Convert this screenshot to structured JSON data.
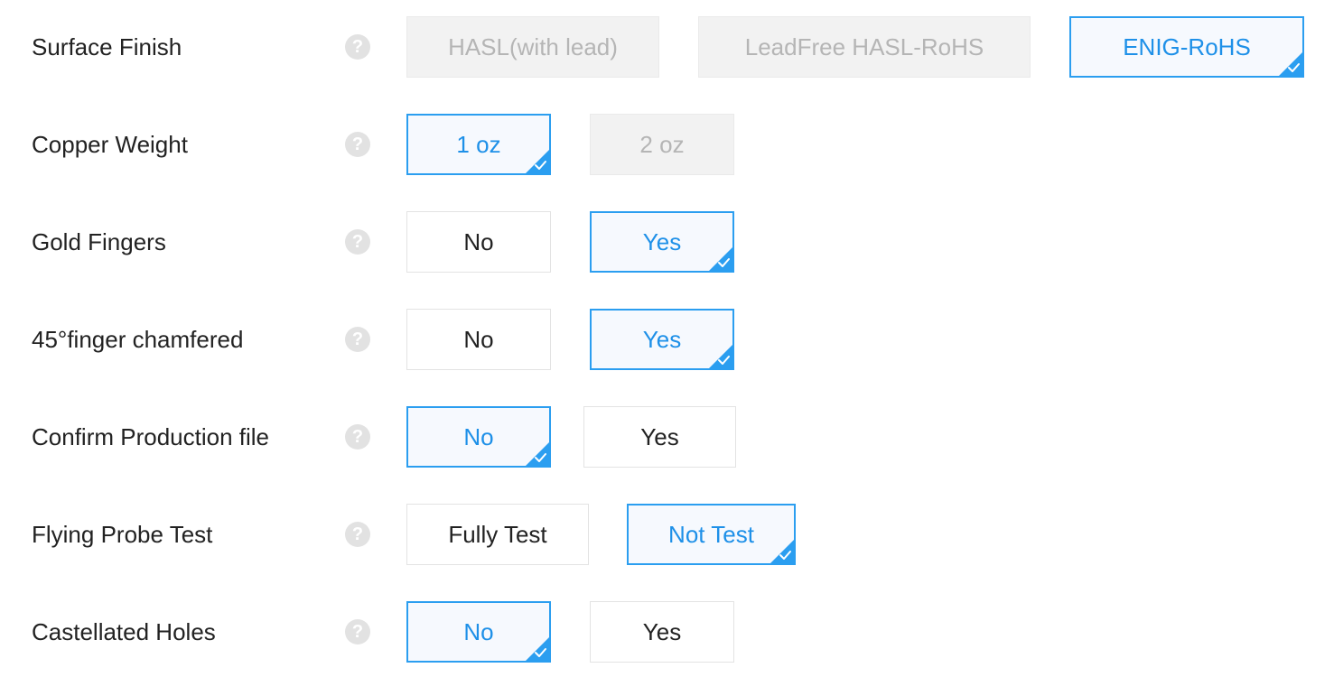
{
  "rows": [
    {
      "label": "Surface Finish",
      "options": [
        {
          "label": "HASL(with lead)",
          "state": "disabled"
        },
        {
          "label": "LeadFree HASL-RoHS",
          "state": "disabled"
        },
        {
          "label": "ENIG-RoHS",
          "state": "selected"
        }
      ]
    },
    {
      "label": "Copper Weight",
      "options": [
        {
          "label": "1 oz",
          "state": "selected"
        },
        {
          "label": "2 oz",
          "state": "disabled"
        }
      ]
    },
    {
      "label": "Gold Fingers",
      "options": [
        {
          "label": "No",
          "state": "normal"
        },
        {
          "label": "Yes",
          "state": "selected"
        }
      ]
    },
    {
      "label": "45°finger chamfered",
      "options": [
        {
          "label": "No",
          "state": "normal"
        },
        {
          "label": "Yes",
          "state": "selected"
        }
      ]
    },
    {
      "label": "Confirm Production file",
      "options": [
        {
          "label": "No",
          "state": "selected"
        },
        {
          "label": "Yes",
          "state": "normal"
        }
      ]
    },
    {
      "label": "Flying Probe Test",
      "options": [
        {
          "label": "Fully Test",
          "state": "normal"
        },
        {
          "label": "Not Test",
          "state": "selected"
        }
      ]
    },
    {
      "label": "Castellated Holes",
      "options": [
        {
          "label": "No",
          "state": "selected"
        },
        {
          "label": "Yes",
          "state": "normal"
        }
      ]
    }
  ],
  "help_icon": {
    "glyph": "?",
    "icon": "question-circle-icon"
  },
  "selected_marker_icon": "check-corner-icon",
  "colors": {
    "accent": "#2b9ef0",
    "selected_text": "#1e90e8",
    "selected_bg": "#f6f9fe",
    "disabled_bg": "#f2f2f2",
    "disabled_text": "#b5b5b5",
    "help_icon_bg": "#e2e2e2",
    "label_text": "#222222"
  }
}
